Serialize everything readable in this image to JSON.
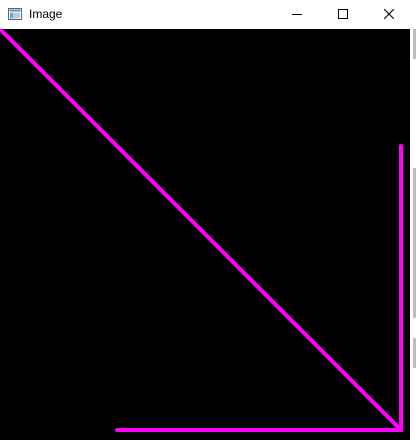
{
  "window": {
    "title": "Image",
    "icon": "image-window-icon",
    "controls": {
      "minimize_icon": "minimize-icon",
      "maximize_icon": "maximize-icon",
      "close_icon": "close-icon"
    }
  },
  "canvas": {
    "background": "#000000",
    "stroke_color": "#ff00ff"
  }
}
